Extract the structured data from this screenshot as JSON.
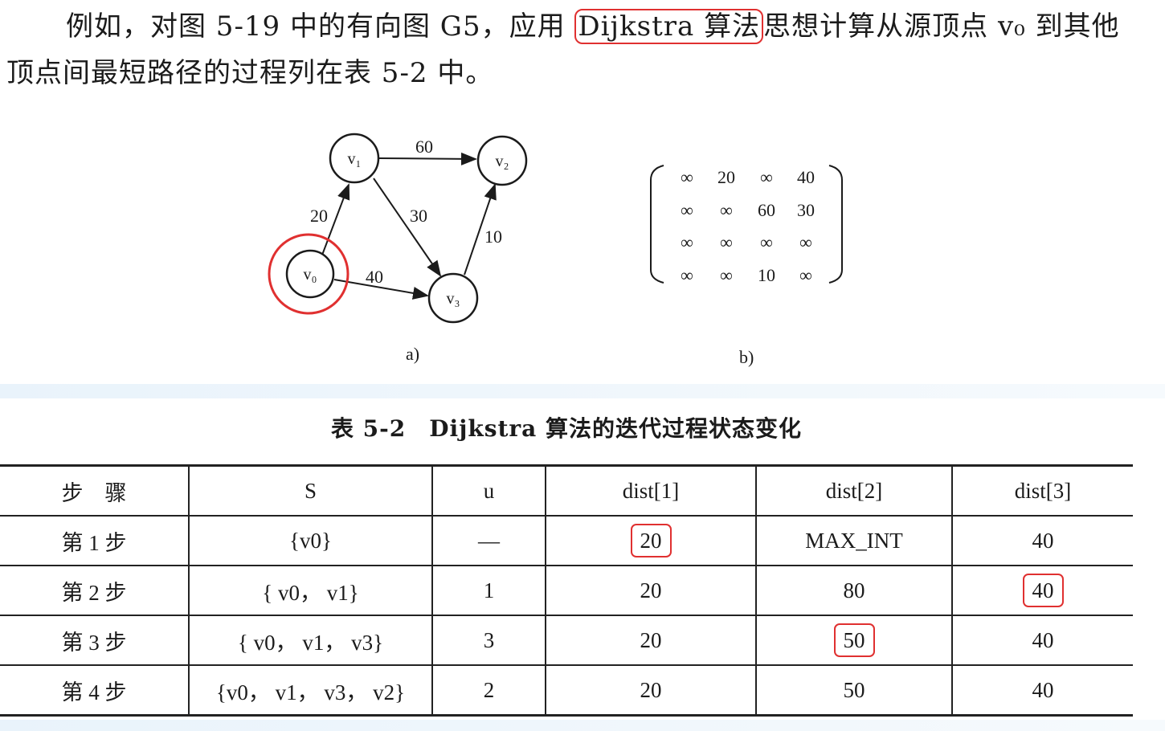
{
  "paragraph": {
    "before": "例如，对图 5-19 中的有向图 G5，应用 ",
    "highlight": "Dijkstra 算法",
    "after": "思想计算从源顶点 v₀ 到其他顶点间最短路径的过程列在表 5-2 中。"
  },
  "figure_a": {
    "caption": "a)",
    "nodes": [
      {
        "id": "v0",
        "label": "v₀",
        "highlighted": true
      },
      {
        "id": "v1",
        "label": "v₁"
      },
      {
        "id": "v2",
        "label": "v₂"
      },
      {
        "id": "v3",
        "label": "v₃"
      }
    ],
    "edges": [
      {
        "from": "v0",
        "to": "v1",
        "weight": "20"
      },
      {
        "from": "v1",
        "to": "v2",
        "weight": "60"
      },
      {
        "from": "v1",
        "to": "v3",
        "weight": "30"
      },
      {
        "from": "v0",
        "to": "v3",
        "weight": "40"
      },
      {
        "from": "v3",
        "to": "v2",
        "weight": "10"
      }
    ]
  },
  "figure_b": {
    "caption": "b)",
    "matrix": [
      [
        "∞",
        "20",
        "∞",
        "40"
      ],
      [
        "∞",
        "∞",
        "60",
        "30"
      ],
      [
        "∞",
        "∞",
        "∞",
        "∞"
      ],
      [
        "∞",
        "∞",
        "10",
        "∞"
      ]
    ]
  },
  "table": {
    "title": "表 5-2　Dijkstra 算法的迭代过程状态变化",
    "headers": [
      "步　骤",
      "S",
      "u",
      "dist[1]",
      "dist[2]",
      "dist[3]"
    ],
    "rows": [
      [
        "第 1 步",
        "{v0}",
        "—",
        "20",
        "MAX_INT",
        "40"
      ],
      [
        "第 2 步",
        "{ v0， v1}",
        "1",
        "20",
        "80",
        "40"
      ],
      [
        "第 3 步",
        "{ v0， v1， v3}",
        "3",
        "20",
        "50",
        "40"
      ],
      [
        "第 4 步",
        "{v0， v1， v3， v2}",
        "2",
        "20",
        "50",
        "40"
      ]
    ],
    "highlighted_cells": [
      {
        "row": 0,
        "col": 3
      },
      {
        "row": 1,
        "col": 5
      },
      {
        "row": 2,
        "col": 4
      }
    ]
  },
  "colors": {
    "highlight": "#e03030",
    "text": "#1b1b1b",
    "band": "#e9f3fb"
  }
}
